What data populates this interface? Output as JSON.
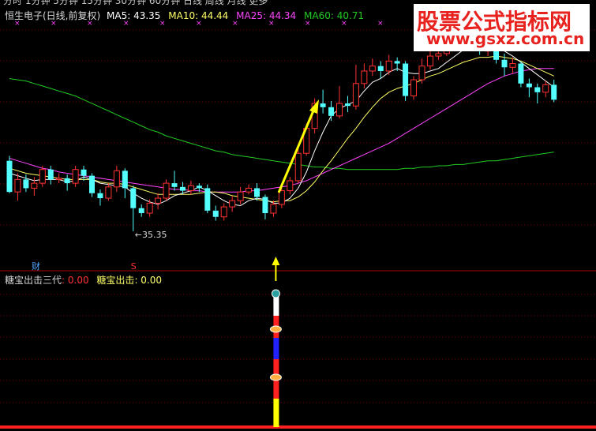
{
  "toolbar": {
    "text": "分时  1分钟  5分钟  15分钟  30分钟  60分钟  日线  周线  月线  更多"
  },
  "watermark": {
    "line1": "股票公式指标网",
    "line2": "www.gsxz.com.cn"
  },
  "legend": {
    "stock": "恒生电子(日线,前复权)",
    "ma5": "MA5: 43.35",
    "ma10": "MA10: 44.44",
    "ma25": "MA25: 44.34",
    "ma60": "MA60: 40.71"
  },
  "annotations": {
    "low_price": "←35.35",
    "fin_mark": "财",
    "s_mark": "S"
  },
  "indicator_legend": {
    "name1": "糖宝出击三代",
    "val1": ": 0.00",
    "name2": "糖宝出击",
    "val2": ": 0.00"
  },
  "colors": {
    "up": "#ff3232",
    "down": "#54ffff",
    "ma5": "#ffffff",
    "ma10": "#ffff66",
    "ma25": "#ff44ff",
    "ma60": "#22cc22",
    "arrow": "#ffff00",
    "grid": "#7a0000"
  },
  "chart_data": {
    "type": "candlestick",
    "price_range": [
      33,
      52
    ],
    "candles": [
      [
        41.0,
        38.5,
        41.4,
        38.4
      ],
      [
        38.5,
        39.5,
        40.0,
        37.8
      ],
      [
        39.5,
        38.8,
        39.9,
        38.5
      ],
      [
        38.8,
        39.2,
        39.7,
        38.2
      ],
      [
        39.2,
        40.3,
        40.6,
        38.9
      ],
      [
        40.3,
        39.5,
        40.6,
        39.1
      ],
      [
        39.5,
        39.6,
        40.0,
        39.2
      ],
      [
        39.6,
        39.2,
        39.9,
        38.6
      ],
      [
        39.2,
        40.3,
        40.6,
        38.9
      ],
      [
        40.3,
        39.8,
        40.6,
        39.4
      ],
      [
        39.8,
        38.4,
        40.0,
        38.1
      ],
      [
        38.4,
        38.0,
        38.7,
        37.4
      ],
      [
        38.0,
        38.9,
        39.2,
        37.8
      ],
      [
        38.9,
        40.2,
        40.6,
        38.5
      ],
      [
        40.2,
        38.8,
        40.4,
        38.0
      ],
      [
        38.8,
        37.2,
        39.0,
        35.35
      ],
      [
        37.2,
        36.8,
        37.5,
        36.5
      ],
      [
        36.8,
        37.6,
        37.9,
        36.5
      ],
      [
        37.6,
        38.0,
        38.4,
        37.1
      ],
      [
        38.0,
        39.2,
        39.5,
        37.8
      ],
      [
        39.2,
        38.9,
        40.2,
        38.6
      ],
      [
        38.9,
        38.6,
        39.3,
        38.3
      ],
      [
        38.6,
        39.0,
        39.4,
        38.3
      ],
      [
        39.0,
        38.8,
        39.2,
        38.5
      ],
      [
        38.8,
        37.0,
        39.1,
        36.8
      ],
      [
        37.0,
        36.5,
        37.4,
        36.2
      ],
      [
        36.5,
        37.3,
        37.6,
        36.2
      ],
      [
        37.3,
        37.8,
        38.2,
        36.9
      ],
      [
        37.8,
        38.5,
        38.9,
        37.5
      ],
      [
        38.5,
        38.8,
        39.1,
        38.3
      ],
      [
        38.8,
        38.1,
        39.2,
        37.8
      ],
      [
        38.1,
        36.8,
        38.3,
        36.3
      ],
      [
        36.8,
        37.5,
        37.8,
        36.5
      ],
      [
        37.5,
        38.6,
        38.9,
        37.2
      ],
      [
        38.6,
        39.4,
        39.7,
        38.3
      ],
      [
        39.4,
        41.6,
        42.0,
        39.2
      ],
      [
        41.6,
        43.6,
        44.0,
        41.4
      ],
      [
        43.6,
        45.6,
        46.0,
        43.2
      ],
      [
        45.6,
        45.3,
        46.7,
        44.8
      ],
      [
        45.3,
        44.6,
        45.8,
        44.2
      ],
      [
        44.6,
        45.6,
        47.0,
        44.4
      ],
      [
        45.6,
        45.4,
        46.2,
        44.9
      ],
      [
        45.4,
        47.2,
        48.7,
        45.1
      ],
      [
        47.2,
        48.2,
        48.8,
        46.8
      ],
      [
        48.2,
        48.6,
        49.2,
        47.8
      ],
      [
        48.6,
        48.2,
        49.0,
        47.6
      ],
      [
        48.2,
        49.0,
        49.5,
        47.9
      ],
      [
        49.0,
        48.8,
        49.3,
        48.2
      ],
      [
        48.8,
        46.2,
        49.0,
        45.8
      ],
      [
        46.2,
        47.5,
        47.8,
        45.9
      ],
      [
        47.5,
        48.6,
        49.2,
        47.2
      ],
      [
        48.6,
        49.4,
        49.8,
        48.3
      ],
      [
        49.4,
        49.6,
        51.4,
        49.1
      ],
      [
        49.6,
        50.9,
        51.2,
        49.4
      ],
      [
        50.9,
        50.6,
        51.6,
        50.3
      ],
      [
        50.6,
        50.8,
        51.2,
        50.2
      ],
      [
        50.8,
        50.6,
        51.2,
        50.0
      ],
      [
        50.6,
        49.8,
        51.0,
        49.5
      ],
      [
        49.8,
        50.3,
        50.8,
        49.4
      ],
      [
        50.3,
        49.1,
        50.6,
        48.8
      ],
      [
        49.1,
        48.5,
        49.6,
        47.8
      ],
      [
        48.5,
        48.8,
        49.3,
        48.0
      ],
      [
        48.8,
        47.2,
        49.0,
        46.9
      ],
      [
        47.2,
        46.9,
        47.6,
        46.1
      ],
      [
        46.9,
        46.5,
        47.2,
        45.6
      ],
      [
        46.5,
        47.1,
        47.4,
        46.1
      ],
      [
        47.1,
        45.9,
        47.5,
        45.7
      ]
    ],
    "ma5": [
      40.0,
      39.8,
      39.6,
      39.4,
      39.5,
      39.5,
      39.5,
      39.3,
      39.4,
      39.7,
      39.5,
      39.2,
      39.1,
      39.0,
      38.9,
      38.4,
      38.0,
      37.7,
      37.5,
      37.8,
      38.2,
      38.4,
      38.6,
      38.9,
      38.6,
      38.2,
      37.8,
      37.5,
      37.4,
      37.8,
      38.0,
      37.9,
      37.6,
      37.6,
      38.0,
      38.8,
      40.1,
      41.8,
      43.3,
      44.6,
      45.2,
      45.5,
      45.8,
      46.6,
      47.3,
      47.6,
      48.1,
      48.4,
      48.1,
      48.0,
      48.0,
      48.2,
      48.4,
      48.9,
      49.4,
      49.9,
      50.2,
      50.4,
      50.3,
      50.1,
      49.8,
      49.4,
      48.9,
      48.4,
      47.9,
      47.4,
      46.9
    ],
    "ma10": [
      40.4,
      40.2,
      40.0,
      39.9,
      39.8,
      39.7,
      39.6,
      39.5,
      39.5,
      39.5,
      39.5,
      39.3,
      39.2,
      39.2,
      39.1,
      38.9,
      38.7,
      38.5,
      38.3,
      38.3,
      38.3,
      38.3,
      38.3,
      38.4,
      38.5,
      38.5,
      38.4,
      38.2,
      38.1,
      38.0,
      37.9,
      37.8,
      37.7,
      37.8,
      37.8,
      38.1,
      38.6,
      39.3,
      40.2,
      41.0,
      41.9,
      42.8,
      43.6,
      44.5,
      45.3,
      46.0,
      46.5,
      46.8,
      47.0,
      47.2,
      47.5,
      47.8,
      48.0,
      48.3,
      48.6,
      48.9,
      49.1,
      49.3,
      49.3,
      49.4,
      49.3,
      49.2,
      49.0,
      48.7,
      48.4,
      48.1,
      47.8
    ],
    "ma25": [
      41.2,
      41.0,
      40.8,
      40.6,
      40.4,
      40.3,
      40.1,
      40.0,
      39.9,
      39.8,
      39.7,
      39.6,
      39.5,
      39.4,
      39.3,
      39.2,
      39.1,
      39.0,
      38.9,
      38.8,
      38.7,
      38.7,
      38.6,
      38.6,
      38.5,
      38.5,
      38.5,
      38.5,
      38.5,
      38.6,
      38.6,
      38.7,
      38.8,
      38.9,
      39.0,
      39.2,
      39.4,
      39.7,
      40.0,
      40.3,
      40.6,
      40.9,
      41.2,
      41.5,
      41.8,
      42.1,
      42.4,
      42.8,
      43.2,
      43.6,
      44.0,
      44.4,
      44.8,
      45.2,
      45.6,
      46.0,
      46.4,
      46.8,
      47.2,
      47.5,
      47.8,
      48.0,
      48.2,
      48.3,
      48.4,
      48.4,
      48.4
    ],
    "ma60": [
      47.6,
      47.5,
      47.4,
      47.2,
      47.0,
      46.8,
      46.6,
      46.4,
      46.2,
      45.9,
      45.6,
      45.3,
      45.0,
      44.7,
      44.4,
      44.1,
      43.8,
      43.5,
      43.3,
      43.0,
      42.8,
      42.6,
      42.4,
      42.2,
      42.0,
      41.8,
      41.7,
      41.5,
      41.4,
      41.3,
      41.2,
      41.1,
      41.0,
      40.9,
      40.8,
      40.7,
      40.6,
      40.5,
      40.5,
      40.4,
      40.4,
      40.3,
      40.3,
      40.3,
      40.3,
      40.3,
      40.3,
      40.3,
      40.4,
      40.4,
      40.5,
      40.5,
      40.6,
      40.6,
      40.7,
      40.7,
      40.8,
      40.9,
      41.0,
      41.0,
      41.1,
      41.2,
      41.3,
      41.4,
      41.5,
      41.6,
      41.7
    ]
  }
}
